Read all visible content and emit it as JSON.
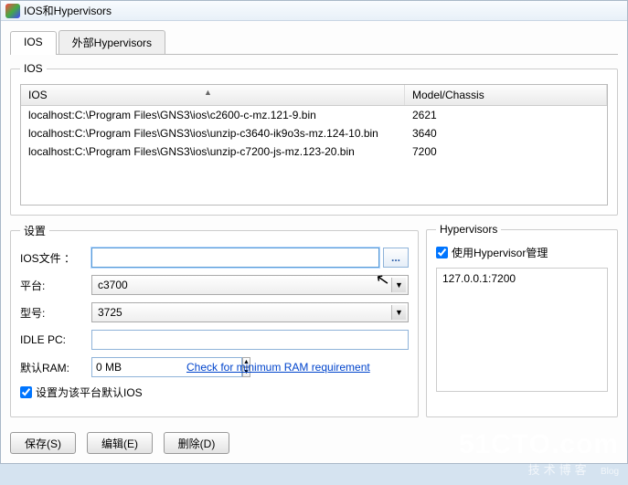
{
  "window": {
    "title": "IOS和Hypervisors"
  },
  "tabs": {
    "ios": "IOS",
    "external": "外部Hypervisors"
  },
  "ios_group": {
    "legend": "IOS",
    "columns": {
      "ios": "IOS",
      "model": "Model/Chassis"
    },
    "rows": [
      {
        "path": "localhost:C:\\Program Files\\GNS3\\ios\\c2600-c-mz.121-9.bin",
        "model": "2621"
      },
      {
        "path": "localhost:C:\\Program Files\\GNS3\\ios\\unzip-c3640-ik9o3s-mz.124-10.bin",
        "model": "3640"
      },
      {
        "path": "localhost:C:\\Program Files\\GNS3\\ios\\unzip-c7200-js-mz.123-20.bin",
        "model": "7200"
      }
    ]
  },
  "settings": {
    "legend": "设置",
    "ios_file_label": "IOS文件 ：",
    "ios_file_value": "",
    "browse_label": "...",
    "platform_label": "平台:",
    "platform_value": "c3700",
    "model_label": "型号:",
    "model_value": "3725",
    "idlepc_label": "IDLE PC:",
    "idlepc_value": "",
    "ram_label": "默认RAM:",
    "ram_value": "0 MB",
    "ram_link": "Check for minimum RAM requirement",
    "default_checkbox": "设置为该平台默认IOS"
  },
  "hypervisors": {
    "legend": "Hypervisors",
    "use_manager": "使用Hypervisor管理",
    "items": [
      "127.0.0.1:7200"
    ]
  },
  "buttons": {
    "save": "保存(S)",
    "edit": "编辑(E)",
    "delete": "删除(D)"
  },
  "watermark": {
    "main": "51CTO.com",
    "sub": "技术博客",
    "blog": "Blog"
  }
}
